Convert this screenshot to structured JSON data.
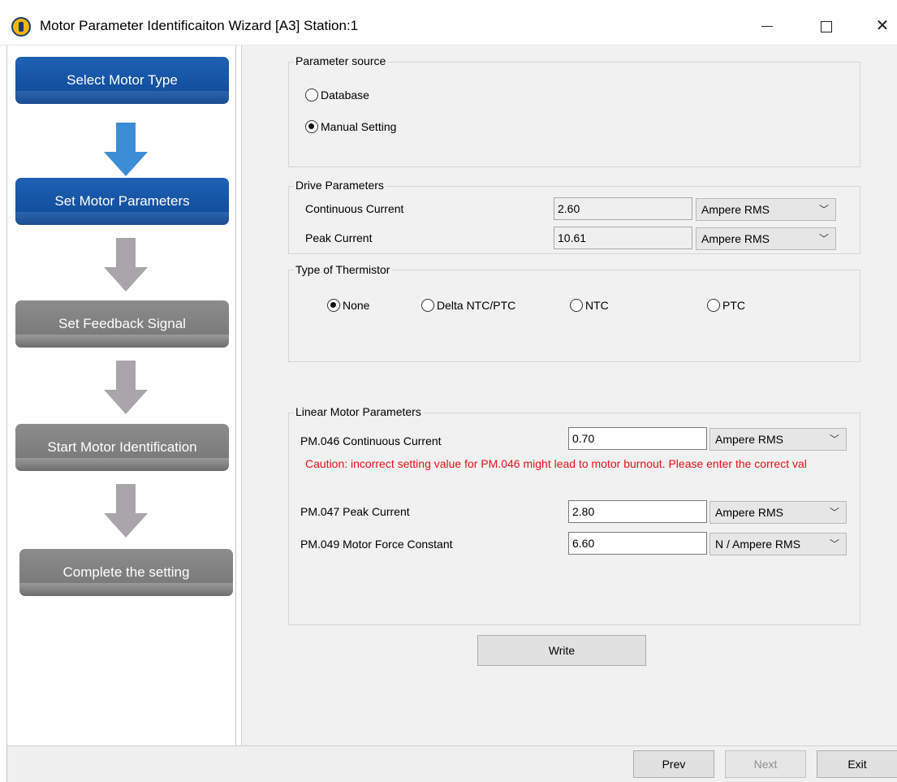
{
  "window": {
    "title": "Motor Parameter Identificaiton Wizard [A3] Station:1",
    "close_glyph": "✕"
  },
  "steps": [
    {
      "label": "Select Motor Type",
      "state": "active"
    },
    {
      "label": "Set Motor Parameters",
      "state": "active"
    },
    {
      "label": "Set Feedback Signal",
      "state": "inactive"
    },
    {
      "label": "Start Motor Identification",
      "state": "inactive"
    },
    {
      "label": "Complete the setting",
      "state": "inactive"
    }
  ],
  "parameter_source": {
    "title": "Parameter source",
    "options": [
      "Database",
      "Manual Setting"
    ],
    "selected": "Manual Setting"
  },
  "drive_parameters": {
    "title": "Drive Parameters",
    "rows": [
      {
        "label": "Continuous Current",
        "value": "2.60",
        "unit": "Ampere RMS"
      },
      {
        "label": "Peak Current",
        "value": "10.61",
        "unit": "Ampere RMS"
      }
    ]
  },
  "thermistor": {
    "title": "Type of Thermistor",
    "options": [
      "None",
      "Delta NTC/PTC",
      "NTC",
      "PTC"
    ],
    "selected": "None"
  },
  "linear_motor": {
    "title": "Linear Motor Parameters",
    "rows": [
      {
        "label": "PM.046 Continuous Current",
        "value": "0.70",
        "unit": "Ampere RMS"
      },
      {
        "label": "PM.047 Peak Current",
        "value": "2.80",
        "unit": "Ampere RMS"
      },
      {
        "label": "PM.049 Motor Force Constant",
        "value": "6.60",
        "unit": "N / Ampere RMS"
      }
    ],
    "caution": "Caution: incorrect setting value for PM.046 might lead to motor burnout. Please enter the correct val"
  },
  "buttons": {
    "write": "Write",
    "prev": "Prev",
    "next": "Next",
    "exit": "Exit"
  },
  "colors": {
    "active_step": "#124f9e",
    "inactive_step": "#7b7b7b",
    "active_arrow": "#3d8dd6",
    "inactive_arrow": "#a8a6a9",
    "caution_text": "#e8111a"
  }
}
